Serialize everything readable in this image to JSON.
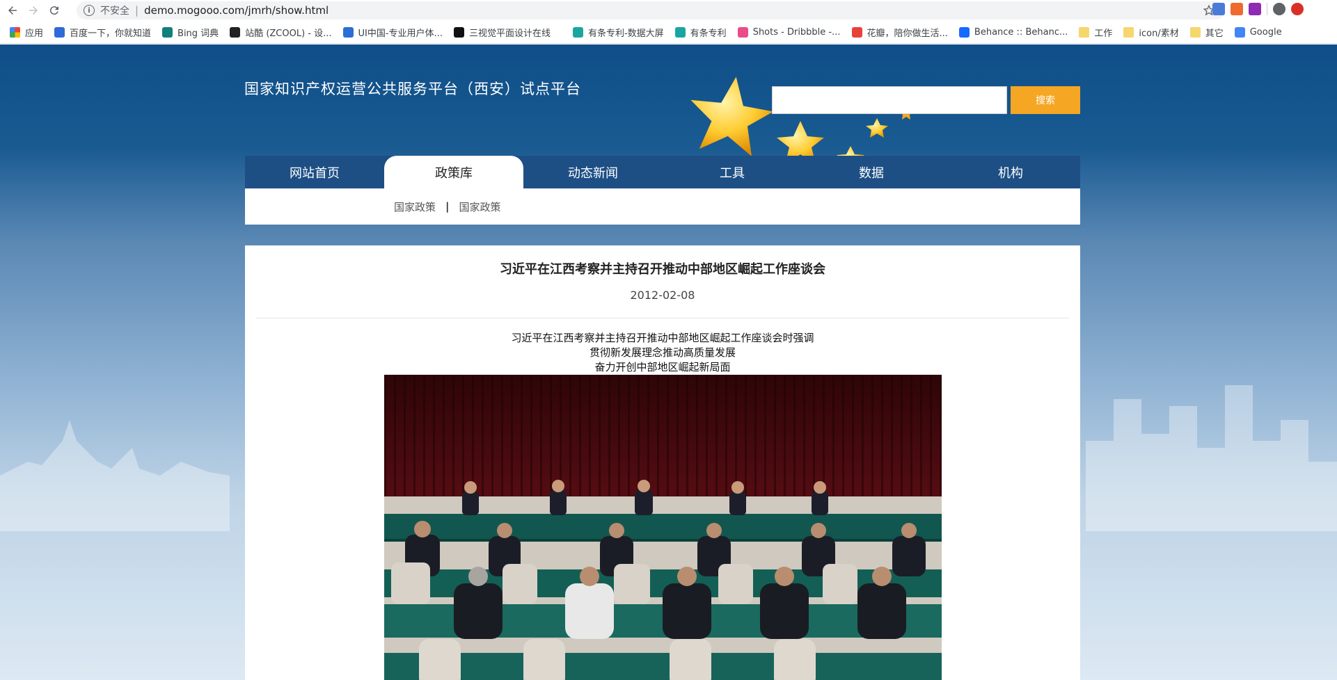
{
  "browser": {
    "security_label": "不安全",
    "url": "demo.mogooo.com/jmrh/show.html",
    "bookmarks": [
      {
        "label": "应用",
        "icon": "apps-grid-icon"
      },
      {
        "label": "百度一下，你就知道",
        "icon": "baidu-icon"
      },
      {
        "label": "Bing 词典",
        "icon": "bing-icon"
      },
      {
        "label": "站酷 (ZCOOL) - 设...",
        "icon": "zcool-icon"
      },
      {
        "label": "UI中国-专业用户体...",
        "icon": "ui-china-icon"
      },
      {
        "label": "三视觉平面设计在线",
        "icon": "sansj-icon"
      },
      {
        "label": "",
        "icon": "page-icon"
      },
      {
        "label": "有条专利-数据大屏",
        "icon": "youtiao-icon"
      },
      {
        "label": "有条专利",
        "icon": "youtiao-icon"
      },
      {
        "label": "Shots - Dribbble -...",
        "icon": "dribbble-icon"
      },
      {
        "label": "花瓣，陪你做生活...",
        "icon": "huaban-icon"
      },
      {
        "label": "Behance :: Behanc...",
        "icon": "behance-icon"
      },
      {
        "label": "工作",
        "icon": "folder-icon"
      },
      {
        "label": "icon/素材",
        "icon": "folder-icon"
      },
      {
        "label": "其它",
        "icon": "folder-icon"
      },
      {
        "label": "Google",
        "icon": "google-icon"
      }
    ]
  },
  "header": {
    "site_title": "国家知识产权运营公共服务平台（西安）试点平台",
    "search_placeholder": "",
    "search_button": "搜索"
  },
  "nav": [
    {
      "label": "网站首页",
      "active": false
    },
    {
      "label": "政策库",
      "active": true
    },
    {
      "label": "动态新闻",
      "active": false
    },
    {
      "label": "工具",
      "active": false
    },
    {
      "label": "数据",
      "active": false
    },
    {
      "label": "机构",
      "active": false
    }
  ],
  "subnav": {
    "items": [
      "国家政策",
      "国家政策"
    ],
    "separator": "|"
  },
  "article": {
    "title": "习近平在江西考察并主持召开推动中部地区崛起工作座谈会",
    "date": "2012-02-08",
    "subheadings": [
      "习近平在江西考察并主持召开推动中部地区崛起工作座谈会时强调",
      "贯彻新发展理念推动高质量发展",
      "奋力开创中部地区崛起新局面"
    ]
  },
  "colors": {
    "nav_bg": "#1d4f85",
    "search_button_bg": "#f5a623",
    "page_top": "#0f4e88"
  }
}
